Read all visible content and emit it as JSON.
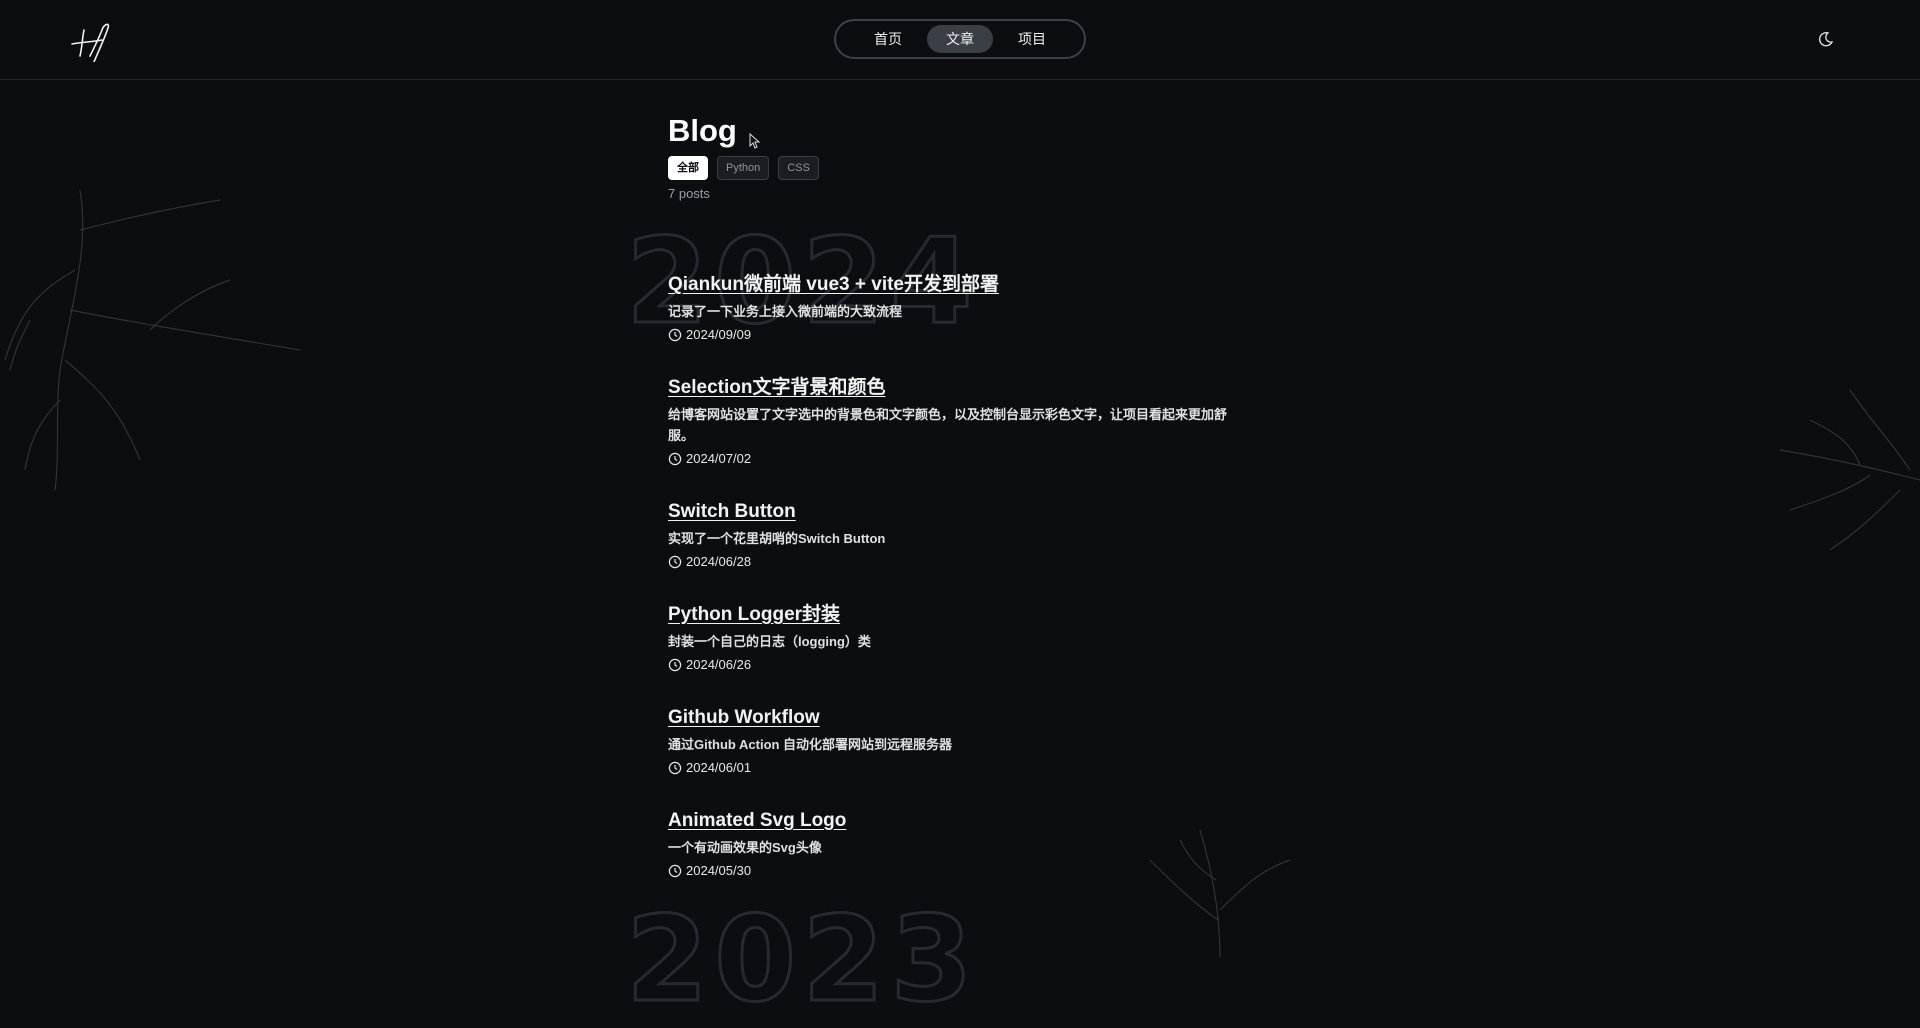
{
  "nav": {
    "items": [
      {
        "label": "首页",
        "active": false
      },
      {
        "label": "文章",
        "active": true
      },
      {
        "label": "项目",
        "active": false
      }
    ],
    "theme_icon": "moon-icon"
  },
  "page": {
    "title": "Blog",
    "tags": [
      {
        "label": "全部",
        "active": true
      },
      {
        "label": "Python",
        "active": false
      },
      {
        "label": "CSS",
        "active": false
      }
    ],
    "count": "7 posts"
  },
  "years": [
    "2024",
    "2023"
  ],
  "posts": [
    {
      "title": "Qiankun微前端 vue3 + vite开发到部署",
      "desc": "记录了一下业务上接入微前端的大致流程",
      "date": "2024/09/09"
    },
    {
      "title": "Selection文字背景和颜色",
      "desc": "给博客网站设置了文字选中的背景色和文字颜色，以及控制台显示彩色文字，让项目看起来更加舒服。",
      "date": "2024/07/02"
    },
    {
      "title": "Switch Button",
      "desc": "实现了一个花里胡哨的Switch Button",
      "date": "2024/06/28"
    },
    {
      "title": "Python Logger封装",
      "desc": "封装一个自己的日志（logging）类",
      "date": "2024/06/26"
    },
    {
      "title": "Github Workflow",
      "desc": "通过Github Action 自动化部署网站到远程服务器",
      "date": "2024/06/01"
    },
    {
      "title": "Animated Svg Logo",
      "desc": "一个有动画效果的Svg头像",
      "date": "2024/05/30"
    }
  ],
  "colors": {
    "background": "#0b0d10",
    "text": "#f2f2f2",
    "muted": "#9aa0a6",
    "nav_active": "#3a3f46"
  }
}
